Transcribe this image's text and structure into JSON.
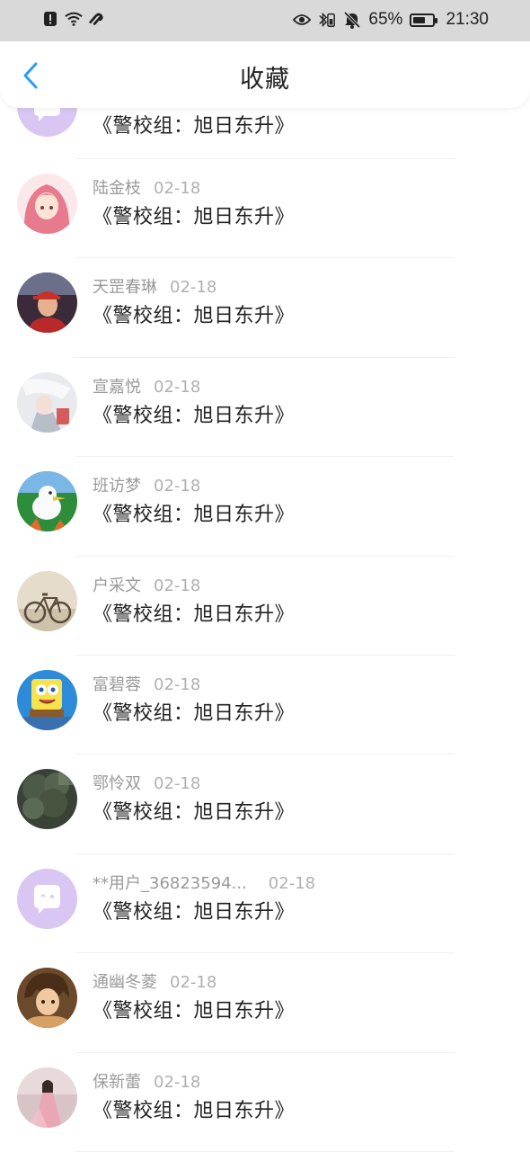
{
  "status_bar": {
    "battery_percent": "65%",
    "battery_level": 0.65,
    "time": "21:30",
    "left_icons": [
      "alert-icon",
      "wifi-icon",
      "link-icon"
    ],
    "right_icons": [
      "eye-icon",
      "bluetooth-icon",
      "mute-bell-icon",
      "battery-icon"
    ]
  },
  "header": {
    "title": "收藏",
    "back_icon": "chevron-left-icon",
    "accent_color": "#2a9df4"
  },
  "items": [
    {
      "user": "",
      "date": "",
      "title": "《警校组：旭日东升》",
      "avatar": "chat-bubble",
      "avatar_colors": [
        "#d9c6f2",
        "#ffffff"
      ]
    },
    {
      "user": "陆金枝",
      "date": "02-18",
      "title": "《警校组：旭日东升》",
      "avatar": "anime-girl",
      "avatar_colors": [
        "#f6c7cf",
        "#e87a8e"
      ]
    },
    {
      "user": "天罡春琳",
      "date": "02-18",
      "title": "《警校组：旭日东升》",
      "avatar": "person-red-cap",
      "avatar_colors": [
        "#3b2b3a",
        "#c4322b"
      ]
    },
    {
      "user": "宣嘉悦",
      "date": "02-18",
      "title": "《警校组：旭日东升》",
      "avatar": "anime-white",
      "avatar_colors": [
        "#e8eaee",
        "#b8bec8"
      ]
    },
    {
      "user": "班访梦",
      "date": "02-18",
      "title": "《警校组：旭日东升》",
      "avatar": "cartoon-duck",
      "avatar_colors": [
        "#2e8d3b",
        "#f4c33b"
      ]
    },
    {
      "user": "户采文",
      "date": "02-18",
      "title": "《警校组：旭日东升》",
      "avatar": "bicycle",
      "avatar_colors": [
        "#e6dccb",
        "#5a4a3a"
      ]
    },
    {
      "user": "富碧蓉",
      "date": "02-18",
      "title": "《警校组：旭日东升》",
      "avatar": "spongebob",
      "avatar_colors": [
        "#2d8bd8",
        "#f5e24c"
      ]
    },
    {
      "user": "鄂怜双",
      "date": "02-18",
      "title": "《警校组：旭日东升》",
      "avatar": "tree-dark",
      "avatar_colors": [
        "#3a4238",
        "#7a8a70"
      ]
    },
    {
      "user": "**用户_36823594...",
      "date": "02-18",
      "title": "《警校组：旭日东升》",
      "avatar": "chat-bubble",
      "avatar_colors": [
        "#d9c6f2",
        "#ffffff"
      ]
    },
    {
      "user": "通幽冬菱",
      "date": "02-18",
      "title": "《警校组：旭日东升》",
      "avatar": "anime-boy",
      "avatar_colors": [
        "#6b4a2b",
        "#d9a066"
      ]
    },
    {
      "user": "保新蕾",
      "date": "02-18",
      "title": "《警校组：旭日东升》",
      "avatar": "girl-pink-dress",
      "avatar_colors": [
        "#d8c4c6",
        "#e9a6b5"
      ]
    }
  ]
}
